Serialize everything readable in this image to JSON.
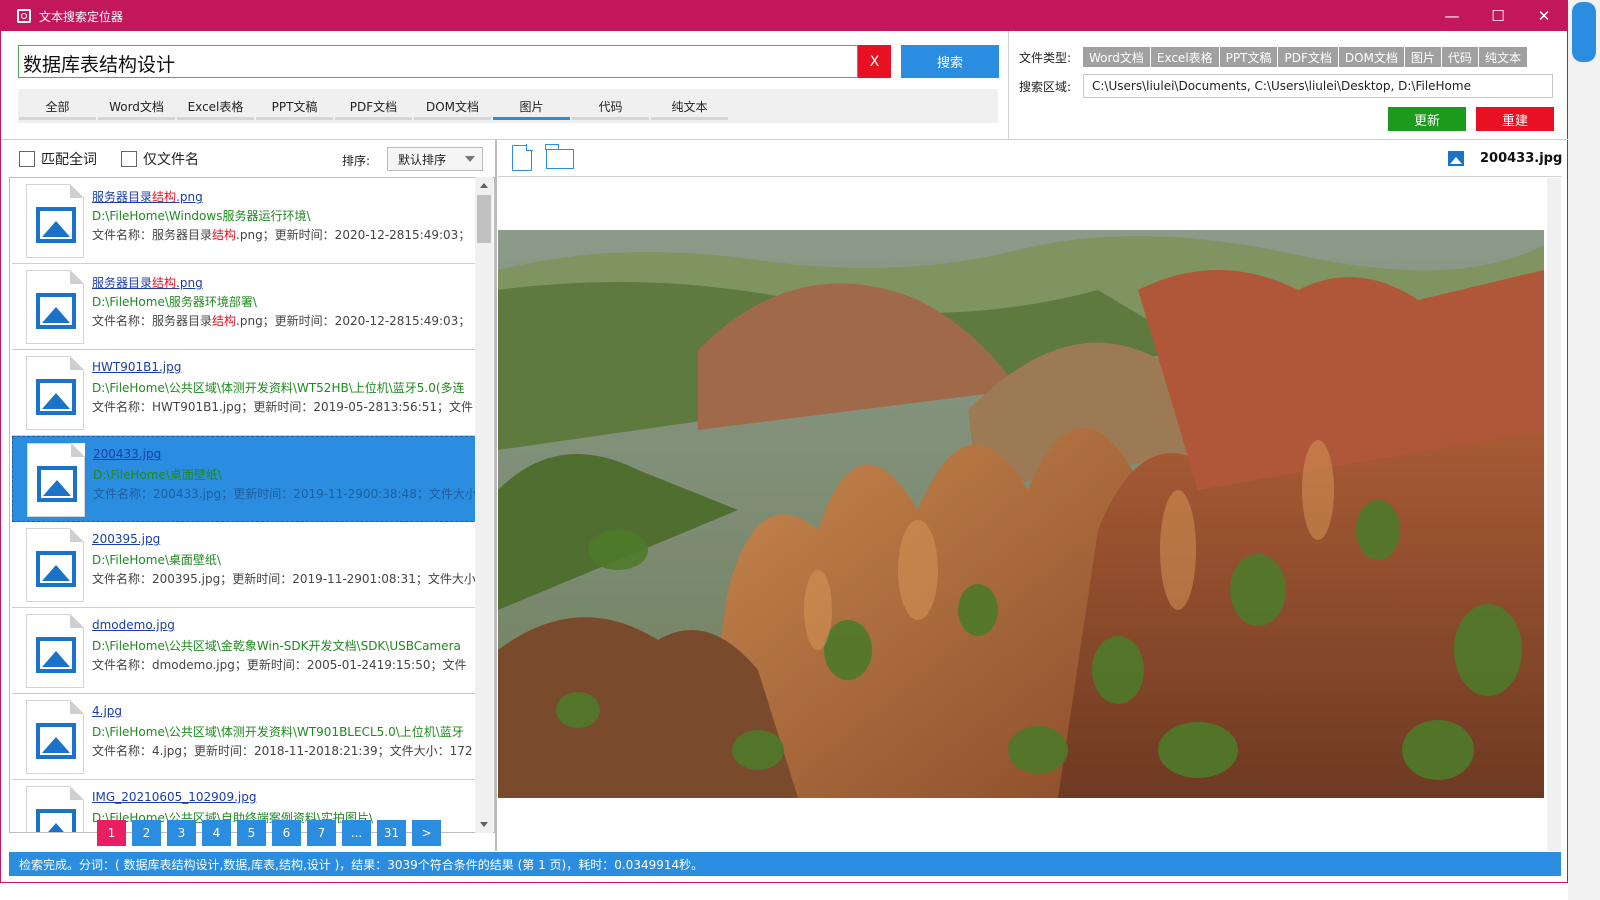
{
  "window": {
    "title": "文本搜索定位器",
    "min_icon": "minimize-icon",
    "max_icon": "maximize-icon",
    "close_icon": "close-icon"
  },
  "search": {
    "query": "数据库表结构设计",
    "clear_label": "X",
    "search_label": "搜索"
  },
  "type_tabs": [
    {
      "label": "全部",
      "active": false
    },
    {
      "label": "Word文档",
      "active": false
    },
    {
      "label": "Excel表格",
      "active": false
    },
    {
      "label": "PPT文稿",
      "active": false
    },
    {
      "label": "PDF文档",
      "active": false
    },
    {
      "label": "DOM文档",
      "active": false
    },
    {
      "label": "图片",
      "active": true
    },
    {
      "label": "代码",
      "active": false
    },
    {
      "label": "纯文本",
      "active": false
    }
  ],
  "config": {
    "file_types_label": "文件类型:",
    "file_types": [
      "Word文档",
      "Excel表格",
      "PPT文稿",
      "PDF文档",
      "DOM文档",
      "图片",
      "代码",
      "纯文本"
    ],
    "search_area_label": "搜索区域:",
    "search_area": "C:\\Users\\liulei\\Documents, C:\\Users\\liulei\\Desktop, D:\\FileHome",
    "update_label": "更新",
    "rebuild_label": "重建"
  },
  "options": {
    "match_whole_word": "匹配全词",
    "filename_only": "仅文件名",
    "sort_label": "排序:",
    "sort_value": "默认排序"
  },
  "results": [
    {
      "name_pre": "服务器目录",
      "name_hl": "结构",
      "name_post": ".png",
      "path": "D:\\FileHome\\Windows服务器运行环境\\",
      "meta_pre": "文件名称：服务器目录",
      "meta_hl": "结构",
      "meta_post": ".png；更新时间：2020-12-2815:49:03；",
      "selected": false
    },
    {
      "name_pre": "服务器目录",
      "name_hl": "结构",
      "name_post": ".png",
      "path": "D:\\FileHome\\服务器环境部署\\",
      "meta_pre": "文件名称：服务器目录",
      "meta_hl": "结构",
      "meta_post": ".png；更新时间：2020-12-2815:49:03；",
      "selected": false
    },
    {
      "name_pre": "HWT901B1.jpg",
      "name_hl": "",
      "name_post": "",
      "path": "D:\\FileHome\\公共区域\\体测开发资料\\WT52HB\\上位机\\蓝牙5.0(多连",
      "meta_pre": "文件名称：HWT901B1.jpg；更新时间：2019-05-2813:56:51；文件",
      "meta_hl": "",
      "meta_post": "",
      "selected": false
    },
    {
      "name_pre": "200433.jpg",
      "name_hl": "",
      "name_post": "",
      "path": "D:\\FileHome\\桌面壁纸\\",
      "meta_pre": "文件名称：200433.jpg；更新时间：2019-11-2900:38:48；文件大小",
      "meta_hl": "",
      "meta_post": "",
      "selected": true
    },
    {
      "name_pre": "200395.jpg",
      "name_hl": "",
      "name_post": "",
      "path": "D:\\FileHome\\桌面壁纸\\",
      "meta_pre": "文件名称：200395.jpg；更新时间：2019-11-2901:08:31；文件大小",
      "meta_hl": "",
      "meta_post": "",
      "selected": false
    },
    {
      "name_pre": "dmodemo.jpg",
      "name_hl": "",
      "name_post": "",
      "path": "D:\\FileHome\\公共区域\\金乾象Win-SDK开发文档\\SDK\\USBCamera",
      "meta_pre": "文件名称：dmodemo.jpg；更新时间：2005-01-2419:15:50；文件",
      "meta_hl": "",
      "meta_post": "",
      "selected": false
    },
    {
      "name_pre": "4.jpg",
      "name_hl": "",
      "name_post": "",
      "path": "D:\\FileHome\\公共区域\\体测开发资料\\WT901BLECL5.0\\上位机\\蓝牙",
      "meta_pre": "文件名称：4.jpg；更新时间：2018-11-2018:21:39；文件大小：172",
      "meta_hl": "",
      "meta_post": "",
      "selected": false
    },
    {
      "name_pre": "IMG_20210605_102909.jpg",
      "name_hl": "",
      "name_post": "",
      "path": "D:\\FileHome\\公共区域\\自助终端案例资料\\实拍图片\\",
      "meta_pre": "",
      "meta_hl": "",
      "meta_post": "",
      "selected": false
    }
  ],
  "pager": {
    "pages": [
      "1",
      "2",
      "3",
      "4",
      "5",
      "6",
      "7",
      "...",
      "31",
      ">"
    ],
    "current": "1"
  },
  "preview": {
    "file_name": "200433.jpg",
    "new_doc_icon": "file-icon",
    "open_folder_icon": "folder-icon"
  },
  "status": "检索完成。分词：( 数据库表结构设计,数据,库表,结构,设计 )，结果：3039个符合条件的结果 (第 1 页)，耗时：0.0349914秒。",
  "colors": {
    "accent": "#c2185b",
    "primary": "#2b8de0",
    "danger": "#e81123",
    "success": "#1c9a1c",
    "path_green": "#1e8a1e"
  }
}
